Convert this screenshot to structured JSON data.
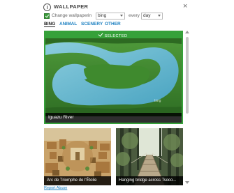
{
  "header": {
    "title": "WALLPAPER",
    "close_glyph": "×",
    "logo_icon": "info-circle-icon"
  },
  "options": {
    "checkbox_checked": true,
    "change_label": "Change wallpaper",
    "in_label": "in",
    "source_value": "bing",
    "every_label": "every",
    "interval_value": "day"
  },
  "tabs": [
    {
      "label": "BING",
      "active": true
    },
    {
      "label": "ANIMAL",
      "active": false
    },
    {
      "label": "SCENERY",
      "active": false
    },
    {
      "label": "OTHER",
      "active": false
    }
  ],
  "featured": {
    "selected_label": "SELECTED",
    "caption": "Iguazu River",
    "watermark": "bing"
  },
  "thumbnails": [
    {
      "caption": "Arc de Triomphe de l'Étoile"
    },
    {
      "caption": "Hanging bridge across Tsoco..."
    }
  ],
  "footer": {
    "report_label": "Report Abuse"
  },
  "colors": {
    "accent_green": "#36a13a",
    "link_blue": "#1a7fc0"
  }
}
